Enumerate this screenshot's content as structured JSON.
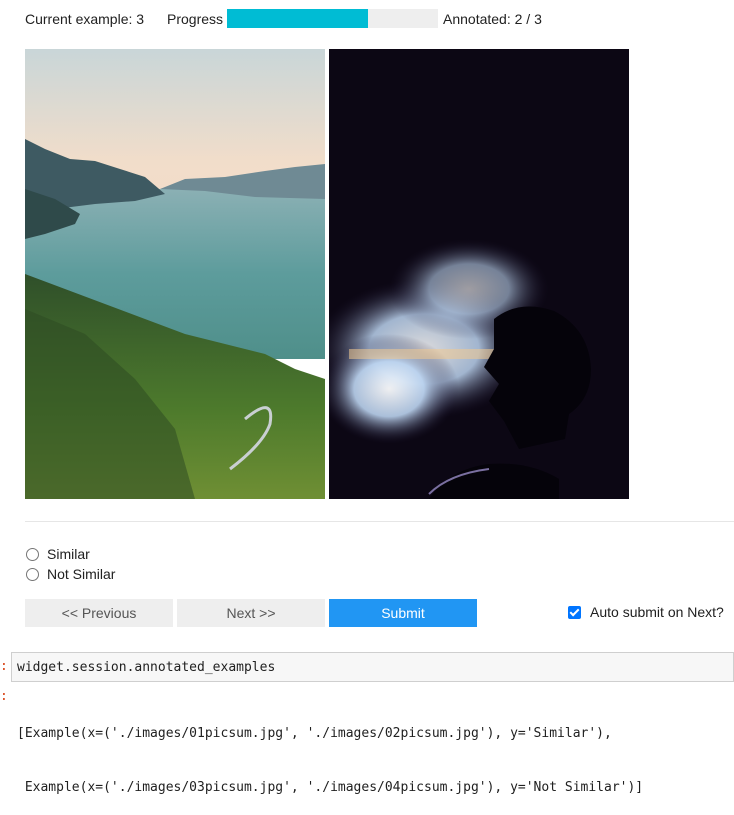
{
  "header": {
    "current_example_label": "Current example: 3",
    "progress_label": "Progress",
    "progress_fraction": 0.67,
    "annotated_label": "Annotated: 2 / 3"
  },
  "options": [
    {
      "label": "Similar",
      "selected": false
    },
    {
      "label": "Not Similar",
      "selected": false
    }
  ],
  "buttons": {
    "previous": "<< Previous",
    "next": "Next >>",
    "submit": "Submit"
  },
  "auto_submit": {
    "label": "Auto submit on Next?",
    "checked": true
  },
  "cell_input": {
    "prompt": ":",
    "code": "widget.session.annotated_examples"
  },
  "cell_output": {
    "prompt": ":",
    "lines": [
      "[Example(x=('./images/01picsum.jpg', './images/02picsum.jpg'), y='Similar'),",
      " Example(x=('./images/03picsum.jpg', './images/04picsum.jpg'), y='Not Similar')]"
    ]
  },
  "colors": {
    "progress": "#00bcd4",
    "submit": "#2196f3",
    "prompt": "#d84315"
  }
}
